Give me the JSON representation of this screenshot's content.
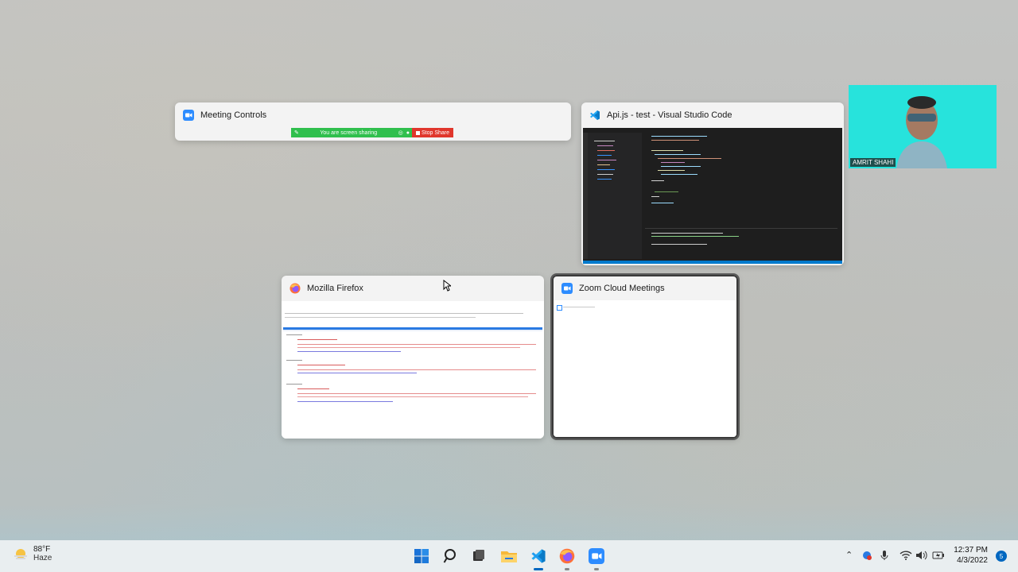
{
  "windows": {
    "meeting_controls": {
      "title": "Meeting Controls",
      "sharing_text": "You are screen sharing",
      "stop_label": "Stop Share"
    },
    "vscode": {
      "title": "Api.js - test - Visual Studio Code"
    },
    "firefox": {
      "title": "Mozilla Firefox"
    },
    "zoom": {
      "title": "Zoom Cloud Meetings"
    }
  },
  "camera": {
    "name": "AMRIT SHAHI"
  },
  "taskbar": {
    "weather": {
      "temp": "88°F",
      "condition": "Haze"
    },
    "apps": [
      "start-icon",
      "search-icon",
      "task-view-icon",
      "file-explorer-icon",
      "vscode-icon",
      "firefox-icon",
      "zoom-icon"
    ],
    "clock": {
      "time": "12:37 PM",
      "date": "4/3/2022"
    },
    "notification_count": "5"
  },
  "colors": {
    "accent": "#0067c0",
    "share_green": "#2fbf4d",
    "share_red": "#e0362c",
    "zoom_blue": "#2d8cff"
  }
}
